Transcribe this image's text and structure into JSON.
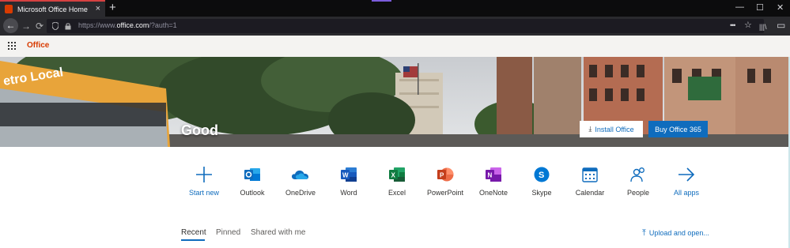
{
  "browser": {
    "tab_title": "Microsoft Office Home",
    "tab_close": "×",
    "new_tab": "+",
    "window_controls": [
      "—",
      "☐",
      "✕"
    ],
    "url_prefix": "https://www.",
    "url_host": "office.com",
    "url_suffix": "/?auth=1",
    "nav": {
      "back": "←",
      "forward": "→",
      "reload": "⟳"
    },
    "url_right": {
      "more": "•••",
      "star": "☆"
    },
    "toolbar_right": {
      "library": "|||\\",
      "sidebar": "▭"
    }
  },
  "header": {
    "brand": "Office"
  },
  "hero": {
    "greeting": "Good",
    "install_label": "Install Office",
    "install_glyph": "⤓",
    "buy_label": "Buy Office 365"
  },
  "apps": [
    {
      "name": "start-new",
      "label": "Start new"
    },
    {
      "name": "outlook",
      "label": "Outlook"
    },
    {
      "name": "onedrive",
      "label": "OneDrive"
    },
    {
      "name": "word",
      "label": "Word"
    },
    {
      "name": "excel",
      "label": "Excel"
    },
    {
      "name": "powerpoint",
      "label": "PowerPoint"
    },
    {
      "name": "onenote",
      "label": "OneNote"
    },
    {
      "name": "skype",
      "label": "Skype"
    },
    {
      "name": "calendar",
      "label": "Calendar"
    },
    {
      "name": "people",
      "label": "People"
    },
    {
      "name": "all-apps",
      "label": "All apps"
    }
  ],
  "tabs": [
    "Recent",
    "Pinned",
    "Shared with me"
  ],
  "upload": {
    "label": "Upload and open...",
    "glyph": "⤒"
  },
  "colors": {
    "brand": "#d83b01",
    "accent": "#0f6cbd",
    "word": "#185abd",
    "excel": "#107c41",
    "powerpoint": "#c43e1c",
    "onenote": "#7719aa",
    "skype": "#0078d4"
  }
}
